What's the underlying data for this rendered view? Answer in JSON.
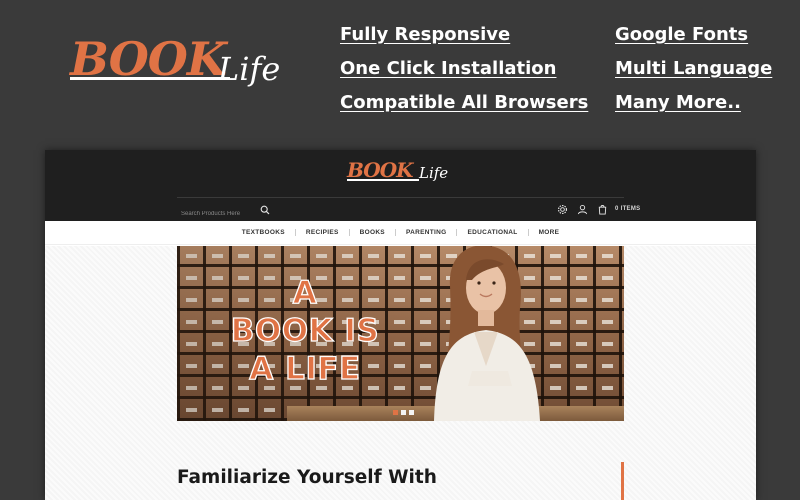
{
  "brand": {
    "logo_primary": "BOOK",
    "logo_secondary": "Life",
    "accent_color": "#e07345"
  },
  "features": {
    "left": [
      "Fully Responsive",
      "One Click Installation",
      "Compatible All Browsers"
    ],
    "right": [
      "Google Fonts",
      "Multi Language",
      "Many More.."
    ]
  },
  "site": {
    "logo_primary": "BOOK",
    "logo_secondary": "Life",
    "search": {
      "placeholder": "Search Products Here",
      "icon": "search-icon"
    },
    "header_icons": [
      "gear-icon",
      "user-icon",
      "cart-icon"
    ],
    "cart_label": "0 ITEMS",
    "nav": [
      "TEXTBOOKS",
      "RECIPIES",
      "BOOKS",
      "PARENTING",
      "EDUCATIONAL",
      "MORE"
    ],
    "hero": {
      "lines": [
        "A",
        "BOOK IS",
        "A LIFE"
      ],
      "slide_count": 3,
      "active_slide": 1
    },
    "section_title": "Familiarize Yourself With"
  }
}
